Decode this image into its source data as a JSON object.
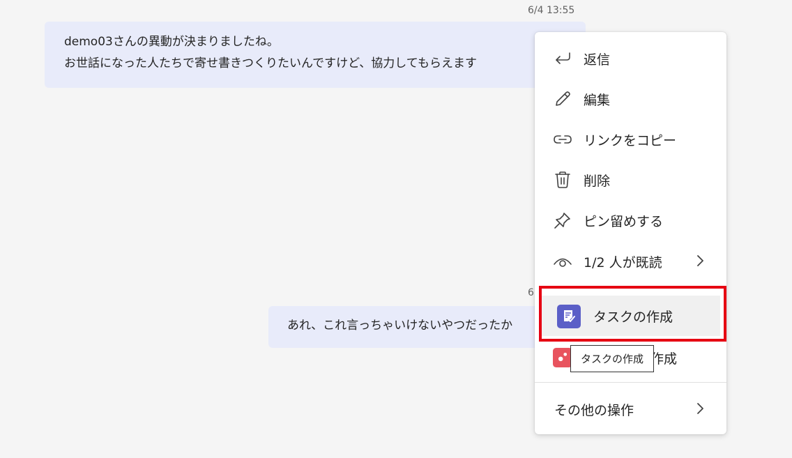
{
  "messages": [
    {
      "timestamp": "6/4 13:55",
      "lines": [
        "demo03さんの異動が決まりましたね。",
        "お世話になった人たちで寄せ書きつくりたいんですけど、協力してもらえます"
      ]
    },
    {
      "timestamp": "6",
      "lines": [
        "あれ、これ言っちゃいけないやつだったか"
      ]
    }
  ],
  "context_menu": {
    "items": [
      {
        "label": "返信",
        "icon": "reply-icon"
      },
      {
        "label": "編集",
        "icon": "pencil-icon"
      },
      {
        "label": "リンクをコピー",
        "icon": "link-icon"
      },
      {
        "label": "削除",
        "icon": "trash-icon"
      },
      {
        "label": "ピン留めする",
        "icon": "pin-icon"
      },
      {
        "label": "1/2 人が既読",
        "icon": "eye-icon"
      }
    ],
    "task_item": {
      "label": "タスクの作成",
      "icon": "planner-task-icon",
      "accent": "#5b5fc7"
    },
    "create_item": {
      "label": "作成",
      "icon": "app-icon",
      "accent": "#e8535e"
    },
    "more_actions": {
      "label": "その他の操作"
    }
  },
  "tooltip": {
    "text": "タスクの作成"
  },
  "highlight_color": "#e60012"
}
